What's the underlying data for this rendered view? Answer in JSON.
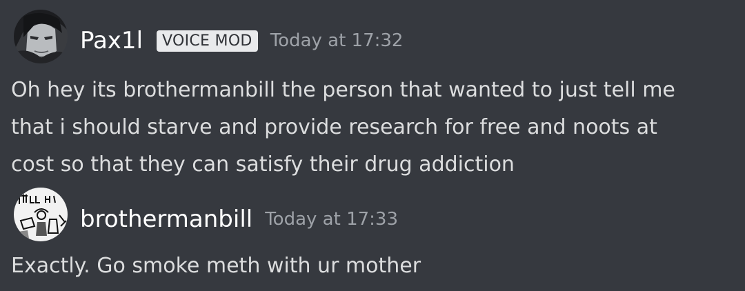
{
  "messages": [
    {
      "author": "Pax1l",
      "role_badge": "VOICE MOD",
      "timestamp": "Today at 17:32",
      "avatar_icon": "dark-character-avatar",
      "lines": [
        "Oh hey its brothermanbill the person that wanted to just tell me",
        "that i should starve and provide research for free and noots at",
        "cost so that they can satisfy their drug addiction"
      ]
    },
    {
      "author": "brothermanbill",
      "timestamp": "Today at 17:33",
      "avatar_icon": "sketch-drawing-avatar",
      "lines": [
        "Exactly. Go smoke meth with ur mother"
      ]
    }
  ],
  "colors": {
    "background": "#36393f",
    "username": "#ffffff",
    "text": "#dcddde",
    "timestamp": "#9ea2a8",
    "badge_bg": "#e9eaec"
  }
}
